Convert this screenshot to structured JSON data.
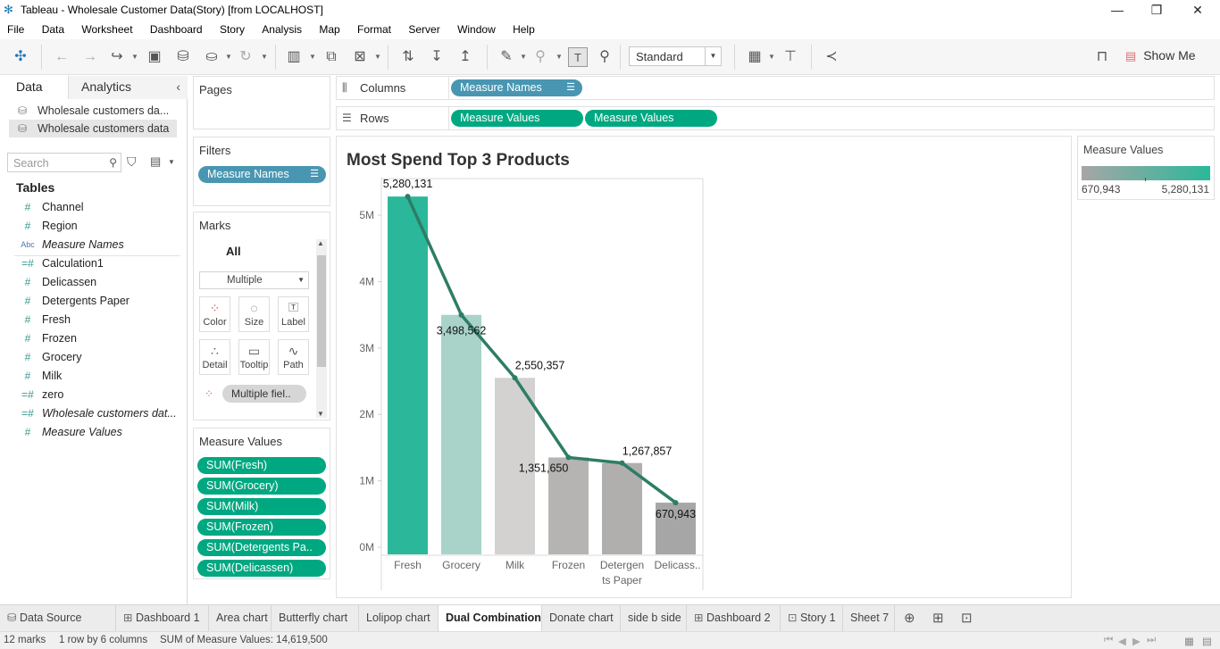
{
  "window": {
    "title": "Tableau - Wholesale Customer Data(Story) [from LOCALHOST]",
    "minimize": "—",
    "restore": "❐",
    "close": "✕"
  },
  "menu": [
    "File",
    "Data",
    "Worksheet",
    "Dashboard",
    "Story",
    "Analysis",
    "Map",
    "Format",
    "Server",
    "Window",
    "Help"
  ],
  "toolbar": {
    "fit_select": "Standard",
    "show_me": "Show Me"
  },
  "data_pane": {
    "tabs": [
      "Data",
      "Analytics"
    ],
    "datasources": [
      "Wholesale customers da...",
      "Wholesale customers data"
    ],
    "search_placeholder": "Search",
    "tables_label": "Tables",
    "fields": [
      {
        "name": "Channel",
        "icon": "#",
        "italic": false
      },
      {
        "name": "Region",
        "icon": "#",
        "italic": false
      },
      {
        "name": "Measure Names",
        "icon": "Abc",
        "italic": true
      },
      {
        "name": "Calculation1",
        "icon": "=#",
        "italic": false
      },
      {
        "name": "Delicassen",
        "icon": "#",
        "italic": false
      },
      {
        "name": "Detergents Paper",
        "icon": "#",
        "italic": false
      },
      {
        "name": "Fresh",
        "icon": "#",
        "italic": false
      },
      {
        "name": "Frozen",
        "icon": "#",
        "italic": false
      },
      {
        "name": "Grocery",
        "icon": "#",
        "italic": false
      },
      {
        "name": "Milk",
        "icon": "#",
        "italic": false
      },
      {
        "name": "zero",
        "icon": "=#",
        "italic": false
      },
      {
        "name": "Wholesale customers dat...",
        "icon": "=#",
        "italic": true
      },
      {
        "name": "Measure Values",
        "icon": "#",
        "italic": true
      }
    ]
  },
  "shelves": {
    "pages": "Pages",
    "filters": "Filters",
    "filter_pill": "Measure Names",
    "columns_label": "Columns",
    "rows_label": "Rows",
    "columns_pill": "Measure Names",
    "rows_pills": [
      "Measure Values",
      "Measure Values"
    ]
  },
  "marks": {
    "header": "Marks",
    "all": "All",
    "type": "Multiple",
    "buttons": [
      "Color",
      "Size",
      "Label",
      "Detail",
      "Tooltip",
      "Path"
    ],
    "pill": "Multiple fiel.."
  },
  "measure_values_card": {
    "header": "Measure Values",
    "pills": [
      "SUM(Fresh)",
      "SUM(Grocery)",
      "SUM(Milk)",
      "SUM(Frozen)",
      "SUM(Detergents Pa..",
      "SUM(Delicassen)"
    ]
  },
  "legend": {
    "title": "Measure Values",
    "min": "670,943",
    "max": "5,280,131",
    "color_low": "#a6a6a6",
    "color_high": "#2bb89a"
  },
  "chart_data": {
    "type": "bar",
    "title": "Most Spend Top 3 Products",
    "categories": [
      "Fresh",
      "Grocery",
      "Milk",
      "Frozen",
      "Detergents Paper",
      "Delicass.."
    ],
    "category_labels": [
      [
        "Fresh"
      ],
      [
        "Grocery"
      ],
      [
        "Milk"
      ],
      [
        "Frozen"
      ],
      [
        "Detergen",
        "ts Paper"
      ],
      [
        "Delicass.."
      ]
    ],
    "values": [
      5280131,
      3498562,
      2550357,
      1351650,
      1267857,
      670943
    ],
    "value_labels": [
      "5,280,131",
      "3,498,562",
      "2,550,357",
      "1,351,650",
      "1,267,857",
      "670,943"
    ],
    "bar_colors": [
      "#2bb89a",
      "#a9d3c8",
      "#d3d2d1",
      "#b5b4b3",
      "#b0afae",
      "#a6a6a6"
    ],
    "line_color": "#2e7d66",
    "ytick_labels": [
      "0M",
      "1M",
      "2M",
      "3M",
      "4M",
      "5M"
    ],
    "ylim": [
      0,
      5300000
    ],
    "xlabel": "",
    "ylabel": "",
    "grid": false,
    "overlay": "line"
  },
  "sheet_tabs": [
    "Data Source",
    "Dashboard 1",
    "Area chart",
    "Butterfly chart",
    "Lolipop chart",
    "Dual Combination",
    "Donate chart",
    "side b side",
    "Dashboard 2",
    "Story 1",
    "Sheet 7"
  ],
  "active_tab": "Dual Combination",
  "status": {
    "marks": "12 marks",
    "dims": "1 row by 6 columns",
    "sum": "SUM of Measure Values: 14,619,500"
  }
}
